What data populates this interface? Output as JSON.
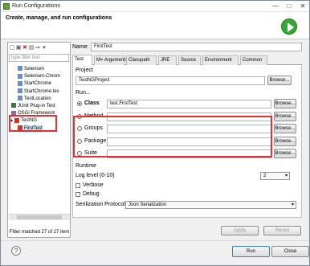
{
  "window": {
    "title": "Run Configurations",
    "minimize": "—",
    "maximize": "□",
    "close": "✕"
  },
  "header": {
    "text": "Create, manage, and run configurations"
  },
  "left": {
    "toolbar": [
      "▢",
      "▣",
      "✖",
      "▤",
      "⇒",
      "▾"
    ],
    "filter_placeholder": "type filter text",
    "tree": [
      {
        "label": "Selenium",
        "indent": 1,
        "icon": "java-icon"
      },
      {
        "label": "Selenium-Chrom",
        "indent": 1,
        "icon": "java-icon"
      },
      {
        "label": "StartChrome",
        "indent": 1,
        "icon": "java-icon"
      },
      {
        "label": "StartChrome.tes",
        "indent": 1,
        "icon": "java-icon"
      },
      {
        "label": "TestLocation",
        "indent": 1,
        "icon": "java-icon"
      },
      {
        "label": "JUnit Plug-in Test",
        "indent": 0,
        "icon": "junit-icon"
      },
      {
        "label": "OSGi Framework",
        "indent": 0,
        "icon": "osgi-icon"
      },
      {
        "label": "TestNG",
        "indent": 0,
        "icon": "testng-icon",
        "expanded": true
      },
      {
        "label": "FirstTest",
        "indent": 1,
        "icon": "testng-icon",
        "selected": true
      }
    ],
    "filtered": "Filter matched 27 of 27 item"
  },
  "name": {
    "label": "Name:",
    "value": "FirstTest"
  },
  "tabs": [
    {
      "label": "Test",
      "selected": true
    },
    {
      "label": "M= Arguments"
    },
    {
      "label": "Classpath"
    },
    {
      "label": "JRE"
    },
    {
      "label": "Source"
    },
    {
      "label": "Environment"
    },
    {
      "label": "Common"
    }
  ],
  "project": {
    "label": "Project",
    "value": "TestNGProject",
    "browse": "Browse..."
  },
  "run": {
    "label": "Run...",
    "options": [
      {
        "label": "Class",
        "value": "test.FirstTest",
        "selected": true
      },
      {
        "label": "Method",
        "value": ""
      },
      {
        "label": "Groups",
        "value": ""
      },
      {
        "label": "Package",
        "value": ""
      },
      {
        "label": "Suite",
        "value": ""
      }
    ],
    "browse": "Browse..."
  },
  "runtime": {
    "label": "Runtime",
    "loglevel_label": "Log level (0-10)",
    "loglevel_value": "2",
    "verbose": "Verbose",
    "debug": "Debug",
    "serialization_label": "Serilization Protocol",
    "serialization_value": "Json Serialization"
  },
  "buttons": {
    "apply": "Apply",
    "revert": "Revert",
    "run": "Run",
    "close": "Close",
    "help": "?"
  },
  "colors": {
    "highlight": "#dd3333",
    "accent": "#3aa63a"
  }
}
